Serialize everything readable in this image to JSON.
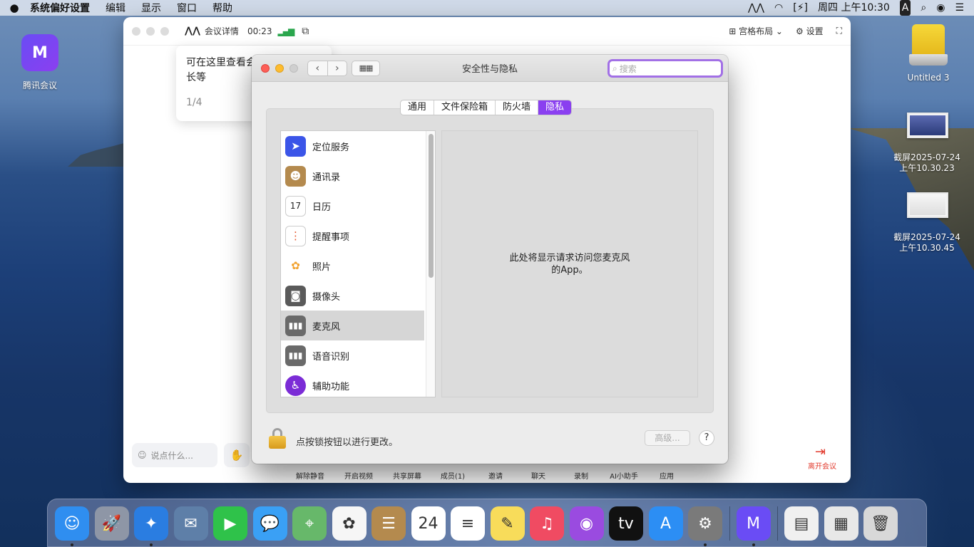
{
  "menubar": {
    "apple_icon": "apple-icon",
    "app_name": "系统偏好设置",
    "menus": [
      "编辑",
      "显示",
      "窗口",
      "帮助"
    ],
    "status": {
      "input_source": "A",
      "datetime": "周四 上午10:30"
    }
  },
  "meeting_window": {
    "detail_label": "会议详情",
    "timer": "00:23",
    "layout_label": "宫格布局",
    "settings_label": "设置",
    "tooltip": {
      "text": "可在这里查看会议号及开会时长等",
      "page": "1/4"
    },
    "chat_placeholder": "说点什么...",
    "toolbar": [
      "解除静音",
      "开启视频",
      "共享屏幕",
      "成员(1)",
      "邀请",
      "聊天",
      "录制",
      "AI小助手",
      "应用"
    ],
    "leave_label": "离开会议"
  },
  "prefs_window": {
    "title": "安全性与隐私",
    "search_placeholder": "搜索",
    "tabs": [
      {
        "label": "通用",
        "active": false
      },
      {
        "label": "文件保险箱",
        "active": false
      },
      {
        "label": "防火墙",
        "active": false
      },
      {
        "label": "隐私",
        "active": true
      }
    ],
    "services": [
      {
        "label": "定位服务",
        "icon": "location-arrow-icon",
        "color": "#3b55e8",
        "selected": false
      },
      {
        "label": "通讯录",
        "icon": "contacts-book-icon",
        "color": "#b48a4e",
        "selected": false
      },
      {
        "label": "日历",
        "icon": "calendar-icon",
        "color": "#ffffff",
        "selected": false
      },
      {
        "label": "提醒事项",
        "icon": "reminders-icon",
        "color": "#ffffff",
        "selected": false
      },
      {
        "label": "照片",
        "icon": "photos-flower-icon",
        "color": "#ffffff",
        "selected": false
      },
      {
        "label": "摄像头",
        "icon": "camera-icon",
        "color": "#5a5a5a",
        "selected": false
      },
      {
        "label": "麦克风",
        "icon": "microphone-waveform-icon",
        "color": "#6a6a6a",
        "selected": true
      },
      {
        "label": "语音识别",
        "icon": "speech-waveform-icon",
        "color": "#6a6a6a",
        "selected": false
      },
      {
        "label": "辅助功能",
        "icon": "accessibility-icon",
        "color": "#7b2cd6",
        "selected": false
      }
    ],
    "detail_text_line1": "此处将显示请求访问您麦克风",
    "detail_text_line2": "的App。",
    "lock_text": "点按锁按钮以进行更改。",
    "advanced_label": "高级...",
    "help_label": "?"
  },
  "desktop": {
    "app_label": "腾讯会议",
    "disk_label": "Untitled 3",
    "screenshots": [
      {
        "line1": "截屏2025-07-24",
        "line2": "上午10.30.23"
      },
      {
        "line1": "截屏2025-07-24",
        "line2": "上午10.30.45"
      }
    ]
  },
  "dock": {
    "items": [
      {
        "name": "finder-icon",
        "glyph": "☺",
        "color": "#2f8ef0",
        "running": true
      },
      {
        "name": "launchpad-icon",
        "glyph": "🚀",
        "color": "#8e96a6",
        "running": false
      },
      {
        "name": "safari-icon",
        "glyph": "✦",
        "color": "#2a7de1",
        "running": true
      },
      {
        "name": "mail-eagle-icon",
        "glyph": "✉",
        "color": "#5e7fa8",
        "running": false
      },
      {
        "name": "facetime-icon",
        "glyph": "▶",
        "color": "#2fc24a",
        "running": false
      },
      {
        "name": "messages-icon",
        "glyph": "💬",
        "color": "#3aa0f5",
        "running": false
      },
      {
        "name": "maps-icon",
        "glyph": "⌖",
        "color": "#67b86a",
        "running": false
      },
      {
        "name": "photos-icon",
        "glyph": "✿",
        "color": "#f6f6f6",
        "running": false
      },
      {
        "name": "contacts-icon",
        "glyph": "☰",
        "color": "#b48a4e",
        "running": false
      },
      {
        "name": "calendar-icon",
        "glyph": "24",
        "color": "#ffffff",
        "running": false
      },
      {
        "name": "reminders-icon",
        "glyph": "≡",
        "color": "#ffffff",
        "running": false
      },
      {
        "name": "notes-icon",
        "glyph": "✎",
        "color": "#f8dc5a",
        "running": false
      },
      {
        "name": "music-icon",
        "glyph": "♫",
        "color": "#f04b62",
        "running": false
      },
      {
        "name": "podcasts-icon",
        "glyph": "◉",
        "color": "#9a4be0",
        "running": false
      },
      {
        "name": "apple-tv-icon",
        "glyph": "tv",
        "color": "#111111",
        "running": false
      },
      {
        "name": "app-store-icon",
        "glyph": "A",
        "color": "#2c8ef4",
        "running": false
      },
      {
        "name": "system-preferences-icon",
        "glyph": "⚙",
        "color": "#7a7a7a",
        "running": true
      },
      {
        "name": "tencent-meeting-icon",
        "glyph": "M",
        "color": "#6a4cf5",
        "running": true
      },
      {
        "name": "document-icon",
        "glyph": "▤",
        "color": "#f0f0f0",
        "running": false
      },
      {
        "name": "screenshot-stack-icon",
        "glyph": "▦",
        "color": "#e8e8e8",
        "running": false
      },
      {
        "name": "trash-icon",
        "glyph": "🗑",
        "color": "#d8d8d8",
        "running": false
      }
    ]
  }
}
